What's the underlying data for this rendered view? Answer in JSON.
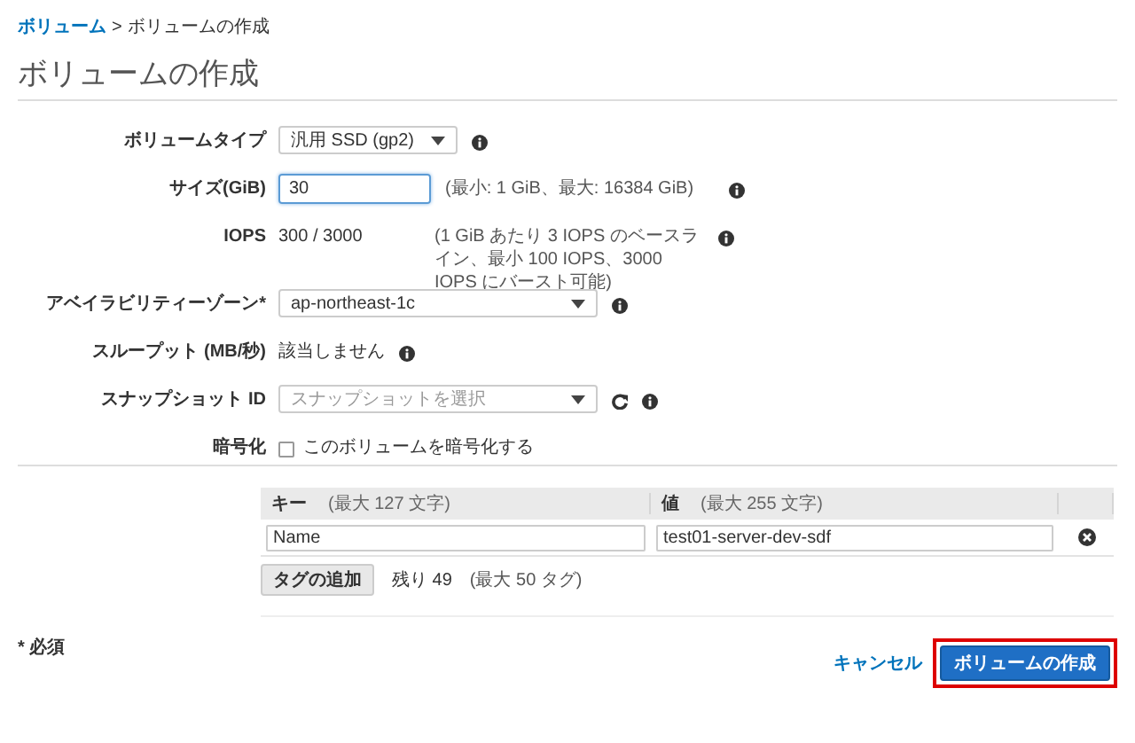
{
  "breadcrumb": [
    {
      "text": "ボリューム",
      "link": true
    },
    {
      "text": ">",
      "link": false
    },
    {
      "text": "ボリュームの作成",
      "link": false
    }
  ],
  "title": "ボリュームの作成",
  "fields": [
    {
      "kind": "dropdown",
      "label": "ボリュームタイプ",
      "value": "汎用 SSD (gp2)",
      "info": true
    },
    {
      "kind": "input",
      "label": "サイズ(GiB)",
      "value": "30",
      "hint": "(最小: 1 GiB、最大: 16384 GiB)",
      "info": true
    },
    {
      "kind": "text",
      "label": "IOPS",
      "value": "300 / 3000",
      "hint": "(1 GiB あたり 3 IOPS のベースライン、最小 100 IOPS、3000 IOPS にバースト可能)",
      "info": true
    },
    {
      "kind": "select",
      "label": "アベイラビリティーゾーン*",
      "value": "ap-northeast-1c",
      "info": true
    },
    {
      "kind": "text",
      "label": "スループット (MB/秒)",
      "value": "該当しません",
      "info": true
    },
    {
      "kind": "select",
      "label": "スナップショット ID",
      "placeholder": "スナップショットを選択",
      "refresh": true,
      "info": true
    },
    {
      "kind": "checkbox",
      "label": "暗号化",
      "value": "このボリュームを暗号化する",
      "checked": false,
      "info": false
    }
  ],
  "tags": {
    "columns": [
      {
        "name": "キー",
        "hint": "(最大 127 文字)"
      },
      {
        "name": "値",
        "hint": "(最大 255 文字)"
      }
    ],
    "rows": [
      {
        "key": "Name",
        "value": "test01-server-dev-sdf"
      }
    ],
    "add_button": "タグの追加",
    "remaining": "残り 49",
    "limit": "(最大 50 タグ)"
  },
  "footer": {
    "required_note": "* 必須",
    "cancel": "キャンセル",
    "create": {
      "label": "ボリュームの作成",
      "highlighted": true
    }
  }
}
